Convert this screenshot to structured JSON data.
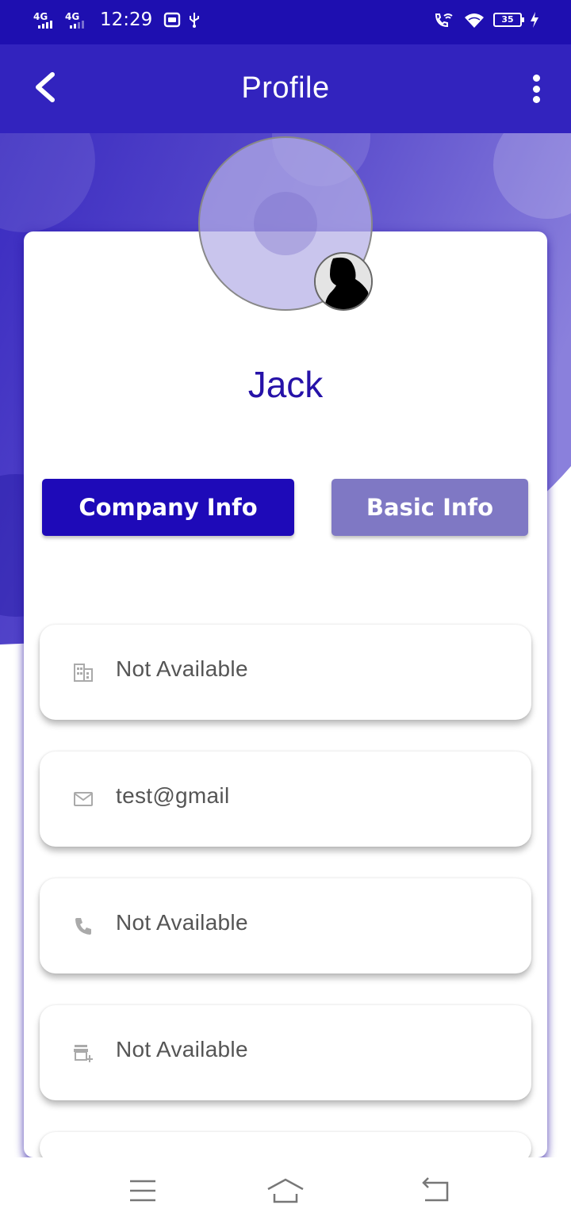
{
  "status_bar": {
    "network1": "4G",
    "network2": "4G",
    "time": "12:29",
    "battery": "35"
  },
  "app_bar": {
    "title": "Profile"
  },
  "profile": {
    "name": "Jack"
  },
  "tabs": {
    "company_info": "Company Info",
    "basic_info": "Basic Info",
    "active": "company_info"
  },
  "info_items": [
    {
      "icon": "building-icon",
      "value": "Not Available"
    },
    {
      "icon": "email-icon",
      "value": "test@gmail"
    },
    {
      "icon": "phone-icon",
      "value": "Not Available"
    },
    {
      "icon": "store-add-icon",
      "value": "Not Available"
    }
  ],
  "colors": {
    "primary": "#1e0ab8",
    "app_bar": "#3223be",
    "accent_light": "#7f78c4",
    "name_text": "#2612a8"
  }
}
